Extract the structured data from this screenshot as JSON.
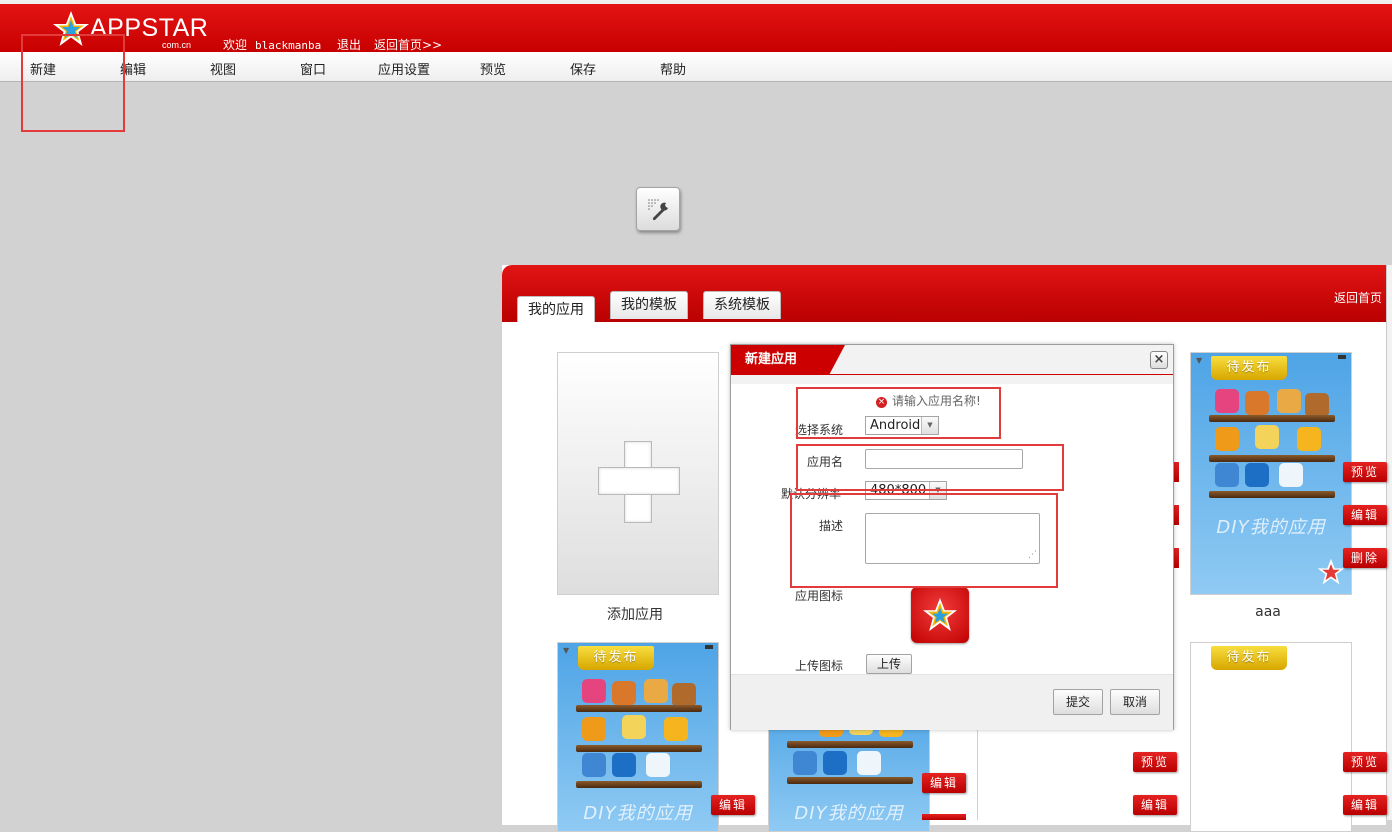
{
  "header": {
    "brand": "APPSTAR",
    "brand_sub": "com.cn",
    "welcome": "欢迎",
    "username": "blackmanba",
    "logout": "退出",
    "home_link": "返回首页>>"
  },
  "menu": [
    "新建",
    "编辑",
    "视图",
    "窗口",
    "应用设置",
    "预览",
    "保存",
    "帮助"
  ],
  "panel": {
    "tabs": [
      "我的应用",
      "我的模板",
      "系统模板"
    ],
    "home": "返回首页"
  },
  "cards": {
    "add_app": "添加应用",
    "aaa_name": "aaa",
    "badge": "待发布",
    "diy_text": "DIY我的应用",
    "preview": "预览",
    "edit": "编辑",
    "delete": "删除"
  },
  "dialog": {
    "title": "新建应用",
    "close": "×",
    "error": "请输入应用名称!",
    "labels": {
      "system": "选择系统",
      "name": "应用名",
      "resolution": "默认分辨率",
      "description": "描述",
      "icon": "应用图标",
      "upload_icon": "上传图标"
    },
    "system_value": "Android",
    "resolution_value": "480*800",
    "name_value": "",
    "description_value": "",
    "upload": "上传",
    "submit": "提交",
    "cancel": "取消"
  },
  "colors": {
    "brand_red": "#cc0000",
    "badge_yellow": "#e8c21a",
    "annotation_red": "#e23b3b"
  }
}
